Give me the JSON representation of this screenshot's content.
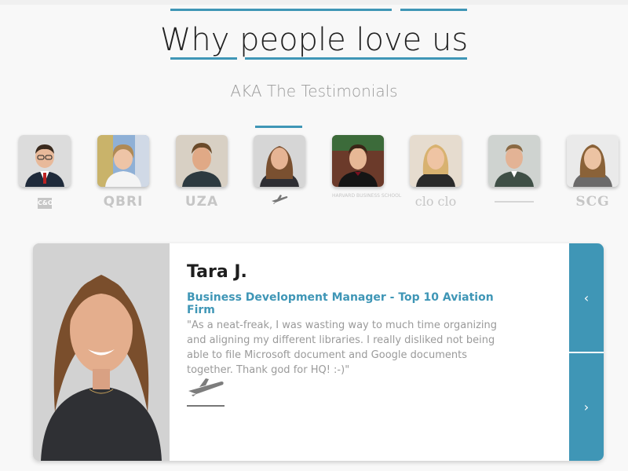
{
  "header": {
    "title": "Why people love us",
    "subtitle": "AKA The Testimonials"
  },
  "colors": {
    "accent": "#3f96b6",
    "background": "#f8f8f8",
    "muted_text": "#9a9a9a"
  },
  "testimonials_strip": [
    {
      "logo": "C&O",
      "active": false
    },
    {
      "logo": "QBRI",
      "active": false
    },
    {
      "logo": "UZA",
      "active": false
    },
    {
      "logo": "plane-icon",
      "active": true
    },
    {
      "logo": "HARVARD BUSINESS SCHOOL",
      "active": false
    },
    {
      "logo": "clo clo",
      "active": false
    },
    {
      "logo": "",
      "active": false
    },
    {
      "logo": "SCG",
      "active": false
    }
  ],
  "featured": {
    "name": "Tara J.",
    "role": "Business Development Manager - Top 10 Aviation Firm",
    "quote": "\"As a neat-freak, I was wasting way to much time organizing and aligning my different libraries. I really disliked not being able to file Microsoft document and Google documents together. Thank god for HQ! :-)\"",
    "logo_icon": "plane-icon"
  },
  "nav": {
    "prev_label": "‹",
    "next_label": "›"
  }
}
